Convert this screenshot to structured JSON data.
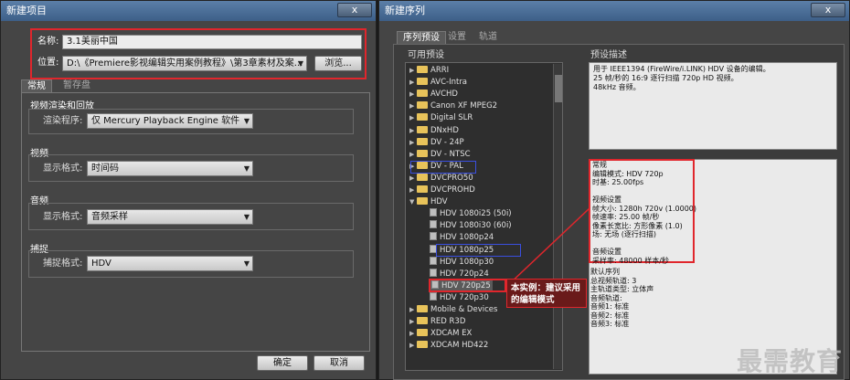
{
  "left_dialog": {
    "title": "新建项目",
    "close": "x",
    "name_label": "名称:",
    "name_value": "3.1美丽中国",
    "location_label": "位置:",
    "location_value": "D:\\《Premiere影视编辑实用案例教程》\\第3章素材及案...",
    "browse": "浏览...",
    "tabs": [
      "常规",
      "暂存盘"
    ],
    "video_render_title": "视频渲染和回放",
    "renderer_label": "渲染程序:",
    "renderer_value": "仅 Mercury Playback Engine 软件",
    "video_title": "视频",
    "video_display_label": "显示格式:",
    "video_display_value": "时间码",
    "audio_title": "音频",
    "audio_display_label": "显示格式:",
    "audio_display_value": "音频采样",
    "capture_title": "捕捉",
    "capture_label": "捕捉格式:",
    "capture_value": "HDV",
    "ok": "确定",
    "cancel": "取消"
  },
  "right_dialog": {
    "title": "新建序列",
    "close": "x",
    "tabs": [
      "序列预设",
      "设置",
      "轨道"
    ],
    "available_presets": "可用预设",
    "preset_description": "预设描述",
    "tree": [
      {
        "label": "ARRI",
        "type": "folder",
        "expanded": false,
        "indent": 0
      },
      {
        "label": "AVC-Intra",
        "type": "folder",
        "expanded": false,
        "indent": 0
      },
      {
        "label": "AVCHD",
        "type": "folder",
        "expanded": false,
        "indent": 0
      },
      {
        "label": "Canon XF MPEG2",
        "type": "folder",
        "expanded": false,
        "indent": 0
      },
      {
        "label": "Digital SLR",
        "type": "folder",
        "expanded": false,
        "indent": 0
      },
      {
        "label": "DNxHD",
        "type": "folder",
        "expanded": false,
        "indent": 0
      },
      {
        "label": "DV - 24P",
        "type": "folder",
        "expanded": false,
        "indent": 0
      },
      {
        "label": "DV - NTSC",
        "type": "folder",
        "expanded": false,
        "indent": 0
      },
      {
        "label": "DV - PAL",
        "type": "folder",
        "expanded": false,
        "indent": 0
      },
      {
        "label": "DVCPRO50",
        "type": "folder",
        "expanded": false,
        "indent": 0
      },
      {
        "label": "DVCPROHD",
        "type": "folder",
        "expanded": false,
        "indent": 0
      },
      {
        "label": "HDV",
        "type": "folder",
        "expanded": true,
        "indent": 0
      },
      {
        "label": "HDV 1080i25 (50i)",
        "type": "file",
        "indent": 1
      },
      {
        "label": "HDV 1080i30 (60i)",
        "type": "file",
        "indent": 1
      },
      {
        "label": "HDV 1080p24",
        "type": "file",
        "indent": 1
      },
      {
        "label": "HDV 1080p25",
        "type": "file",
        "indent": 1
      },
      {
        "label": "HDV 1080p30",
        "type": "file",
        "indent": 1
      },
      {
        "label": "HDV 720p24",
        "type": "file",
        "indent": 1
      },
      {
        "label": "HDV 720p25",
        "type": "file",
        "indent": 1,
        "selected": true
      },
      {
        "label": "HDV 720p30",
        "type": "file",
        "indent": 1
      },
      {
        "label": "Mobile & Devices",
        "type": "folder",
        "expanded": false,
        "indent": 0
      },
      {
        "label": "RED R3D",
        "type": "folder",
        "expanded": false,
        "indent": 0
      },
      {
        "label": "XDCAM EX",
        "type": "folder",
        "expanded": false,
        "indent": 0
      },
      {
        "label": "XDCAM HD422",
        "type": "folder",
        "expanded": false,
        "indent": 0
      }
    ],
    "desc_top": [
      "用于 IEEE1394 (FireWire/i.LINK) HDV 设备的编辑。",
      "25 帧/秒的 16:9 逐行扫描 720p HD 视频。",
      "48kHz 音频。"
    ],
    "general": [
      "常规",
      "编辑模式: HDV 720p",
      "时基: 25.00fps",
      "",
      "视频设置",
      "帧大小: 1280h 720v (1.0000)",
      "帧速率: 25.00 帧/秒",
      "像素长宽比: 方形像素 (1.0)",
      "场: 无场 (逐行扫描)",
      "",
      "音频设置",
      "采样率: 48000 样本/秒"
    ],
    "default_sequence": [
      "默认序列",
      "总视频轨道: 3",
      "主轨道类型: 立体声",
      "音频轨道:",
      "音频1: 标准",
      "音频2: 标准",
      "音频3: 标准"
    ],
    "callout": "本实例：建议采用的编辑模式"
  },
  "watermark": "最需教育"
}
